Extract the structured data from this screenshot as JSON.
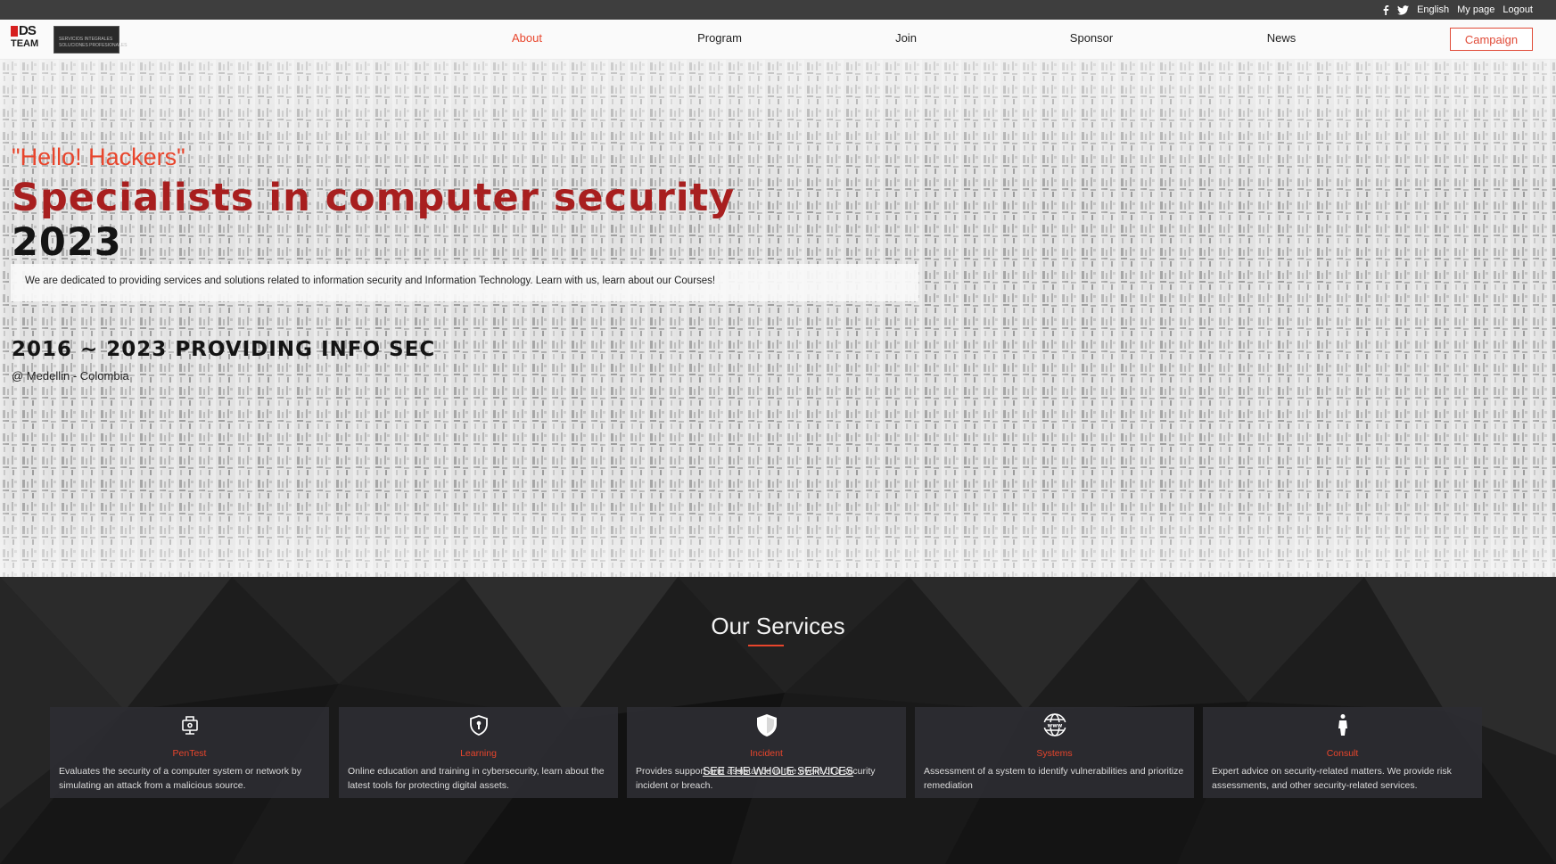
{
  "topbar": {
    "facebook_icon": "facebook-icon",
    "twitter_icon": "twitter-icon",
    "language": "English",
    "my_page": "My page",
    "logout": "Logout"
  },
  "navbar": {
    "logo_line1": "DS",
    "logo_line2": "TEAM",
    "secondary_logo_line1": "SERVICIOS INTEGRALES",
    "secondary_logo_line2": "SOLUCIONES PROFESIONALES",
    "links": [
      "About",
      "Program",
      "Join",
      "Sponsor",
      "News"
    ],
    "active_link": "About",
    "campaign": "Campaign"
  },
  "hero": {
    "greeting": "\"Hello! Hackers\"",
    "headline_line1": "Specialists in computer security",
    "headline_line2": "2023",
    "description": "We are dedicated to providing services and solutions related to information security and Information Technology. Learn with us, learn about our Courses!",
    "years": "2016 ~ 2023 PROVIDING INFO SEC",
    "location": "@ Medellin - Colombia"
  },
  "services": {
    "title": "Our Services",
    "cards": [
      {
        "icon": "network-computer-icon",
        "title": "PenTest",
        "description": "Evaluates the security of a computer system or network by simulating an attack from a malicious source."
      },
      {
        "icon": "shield-lock-icon",
        "title": "Learning",
        "description": "Online education and training in cybersecurity, learn about the latest tools for protecting digital assets."
      },
      {
        "icon": "shield-icon",
        "title": "Incident",
        "description": "Provides support and assistance in the event of a security incident or breach."
      },
      {
        "icon": "www-globe-icon",
        "title": "Systems",
        "description": "Assessment of a system to identify vulnerabilities and prioritize remediation"
      },
      {
        "icon": "person-icon",
        "title": "Consult",
        "description": "Expert advice on security-related matters. We provide risk assessments, and other security-related services."
      }
    ],
    "see_all": "SEE THE WHOLE SERVICES"
  },
  "colors": {
    "accent": "#e8452c",
    "topbar": "#3e3e3e",
    "headline": "#a81f1f",
    "services_bg": "#1f1f1f"
  }
}
